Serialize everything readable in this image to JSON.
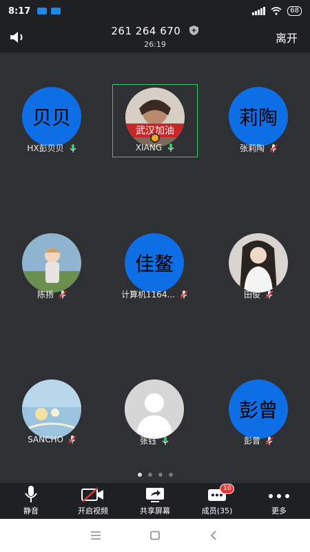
{
  "status_bar": {
    "time": "8:17",
    "battery": "68"
  },
  "header": {
    "meeting_id": "261 264 670",
    "duration": "26:19",
    "leave_label": "离开"
  },
  "participants": [
    {
      "name": "HX彭贝贝",
      "avatar_text": "贝贝",
      "mic": "on"
    },
    {
      "name": "XIANG",
      "avatar_text": "",
      "mic": "on",
      "photo_text": "武汉加油"
    },
    {
      "name": "张莉陶",
      "avatar_text": "莉陶",
      "mic": "muted"
    },
    {
      "name": "陈扬",
      "avatar_text": "",
      "mic": "muted"
    },
    {
      "name": "计算机1164...",
      "avatar_text": "佳鳌",
      "mic": "muted"
    },
    {
      "name": "田俊",
      "avatar_text": "",
      "mic": "muted"
    },
    {
      "name": "SANCHO",
      "avatar_text": "",
      "mic": "muted"
    },
    {
      "name": "张钰",
      "avatar_text": "",
      "mic": "on"
    },
    {
      "name": "彭曾",
      "avatar_text": "彭曾",
      "mic": "muted"
    }
  ],
  "page_indicator": {
    "pages": 4,
    "current": 1
  },
  "toolbar": {
    "mute_label": "静音",
    "video_label": "开启视频",
    "share_label": "共享屏幕",
    "members_label": "成员(35)",
    "members_badge": "10",
    "more_label": "更多"
  },
  "colors": {
    "accent_blue": "#0e6ee6",
    "active_border": "#2ecc71",
    "mic_on": "#2ecc71",
    "mic_muted": "#e53935"
  }
}
